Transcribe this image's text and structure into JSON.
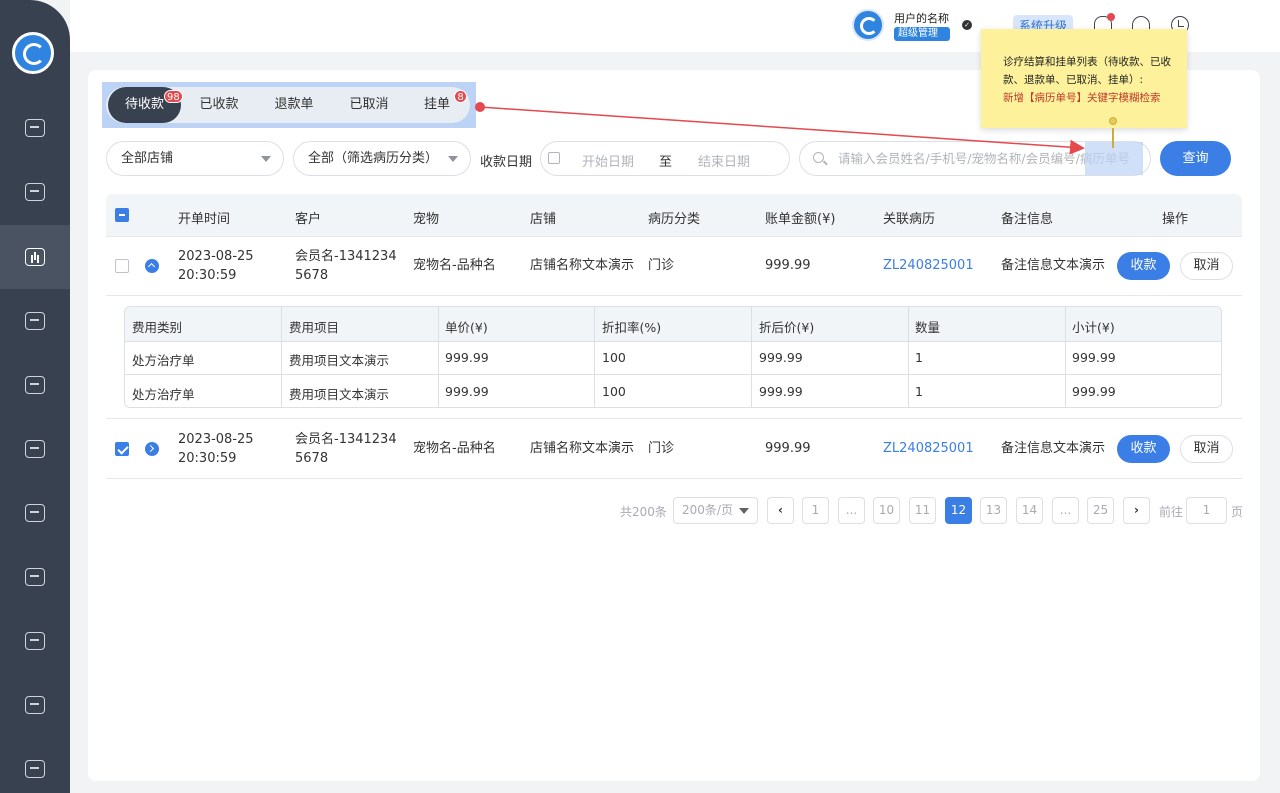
{
  "topbar": {
    "user_name": "用户的名称",
    "user_role": "超级管理员",
    "upgrade_label": "系统升级"
  },
  "tabs": [
    {
      "label": "待收款",
      "badge": "98",
      "active": true
    },
    {
      "label": "已收款",
      "badge": "",
      "active": false
    },
    {
      "label": "退款单",
      "badge": "",
      "active": false
    },
    {
      "label": "已取消",
      "badge": "",
      "active": false
    },
    {
      "label": "挂单",
      "badge": "8",
      "active": false
    }
  ],
  "filters": {
    "store_select": "全部店铺",
    "category_select": "全部（筛选病历分类）",
    "date_label": "收款日期",
    "date_start_placeholder": "开始日期",
    "date_sep": "至",
    "date_end_placeholder": "结束日期",
    "search_placeholder": "请输入会员姓名/手机号/宠物名称/会员编号/病历单号",
    "query_button": "查询"
  },
  "annotation": {
    "line1": "诊疗结算和挂单列表（待收款、已收款、退款单、已取消、挂单）:",
    "line2": "新增【病历单号】关键字模糊检索"
  },
  "table": {
    "columns": [
      "开单时间",
      "客户",
      "宠物",
      "店铺",
      "病历分类",
      "账单金额(¥)",
      "关联病历",
      "备注信息",
      "操作"
    ],
    "rows": [
      {
        "time_date": "2023-08-25",
        "time_clock": "20:30:59",
        "customer_line1": "会员名-1341234",
        "customer_line2": "5678",
        "pet": "宠物名-品种名",
        "store": "店铺名称文本演示",
        "category": "门诊",
        "amount": "999.99",
        "record": "ZL240825001",
        "note": "备注信息文本演示",
        "pay_label": "收款",
        "cancel_label": "取消",
        "checked": false,
        "expanded": true
      },
      {
        "time_date": "2023-08-25",
        "time_clock": "20:30:59",
        "customer_line1": "会员名-1341234",
        "customer_line2": "5678",
        "pet": "宠物名-品种名",
        "store": "店铺名称文本演示",
        "category": "门诊",
        "amount": "999.99",
        "record": "ZL240825001",
        "note": "备注信息文本演示",
        "pay_label": "收款",
        "cancel_label": "取消",
        "checked": true,
        "expanded": false
      }
    ]
  },
  "subtable": {
    "columns": [
      "费用类别",
      "费用项目",
      "单价(¥)",
      "折扣率(%)",
      "折后价(¥)",
      "数量",
      "小计(¥)"
    ],
    "rows": [
      [
        "处方治疗单",
        "费用项目文本演示",
        "999.99",
        "100",
        "999.99",
        "1",
        "999.99"
      ],
      [
        "处方治疗单",
        "费用项目文本演示",
        "999.99",
        "100",
        "999.99",
        "1",
        "999.99"
      ]
    ]
  },
  "pagination": {
    "total": "共200条",
    "page_size": "200条/页",
    "prev": "‹",
    "next": "›",
    "pages": [
      "1",
      "...",
      "10",
      "11",
      "12",
      "13",
      "14",
      "...",
      "25"
    ],
    "current": "12",
    "goto_label": "前往",
    "goto_value": "1",
    "page_label": "页"
  },
  "colors": {
    "primary": "#3b7ee6",
    "sidebar": "#38414f",
    "badge": "#e5484d",
    "annotation_bg": "#fdf29b"
  }
}
